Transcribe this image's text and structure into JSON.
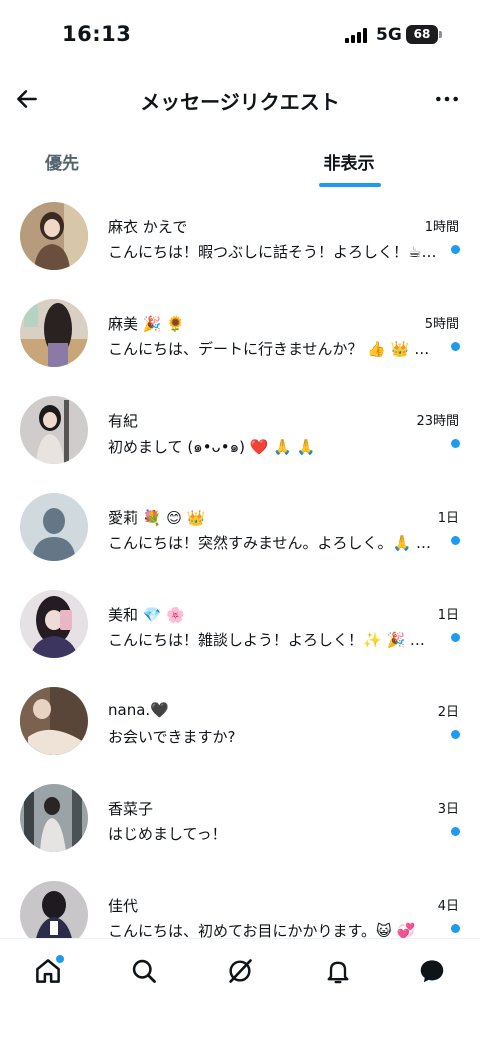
{
  "status_bar": {
    "time": "16:13",
    "network": "5G",
    "battery": "68"
  },
  "header": {
    "title": "メッセージリクエスト",
    "back_icon": "arrow-left-icon",
    "more_icon": "more-horizontal-icon"
  },
  "tabs": [
    {
      "label": "優先",
      "selected": false
    },
    {
      "label": "非表示",
      "selected": true
    }
  ],
  "requests": [
    {
      "name": "麻衣 かえで",
      "time": "1時間",
      "preview": "こんにちは！暇つぶしに話そう！よろしく！☕ …",
      "unread": true
    },
    {
      "name": "麻美 🎉 🌻",
      "time": "5時間",
      "preview": "こんにちは、デートに行きませんか？ 👍 👑 …",
      "unread": true
    },
    {
      "name": "有紀",
      "time": "23時間",
      "preview": "初めまして (๑•ᴗ•๑) ❤️ 🙏 🙏",
      "unread": true
    },
    {
      "name": "愛莉 💐 😊 👑",
      "time": "1日",
      "preview": "こんにちは！突然すみません。よろしく。🙏 …",
      "unread": true
    },
    {
      "name": "美和 💎 🌸",
      "time": "1日",
      "preview": "こんにちは！雑談しよう！よろしく！✨ 🎉 …",
      "unread": true
    },
    {
      "name": "nana.🖤",
      "time": "2日",
      "preview": "お会いできますか?",
      "unread": true
    },
    {
      "name": "香菜子",
      "time": "3日",
      "preview": "はじめましてっ！",
      "unread": true
    },
    {
      "name": "佳代",
      "time": "4日",
      "preview": "こんにちは、初めてお目にかかります。😺 💞",
      "unread": true
    }
  ],
  "bottom_nav": [
    {
      "icon": "home-icon",
      "badge": true
    },
    {
      "icon": "search-icon",
      "badge": false
    },
    {
      "icon": "grok-icon",
      "badge": false
    },
    {
      "icon": "bell-icon",
      "badge": false
    },
    {
      "icon": "messages-icon",
      "badge": false
    }
  ],
  "colors": {
    "accent": "#1d9bf0",
    "text": "#0f1419",
    "muted": "#536471"
  }
}
